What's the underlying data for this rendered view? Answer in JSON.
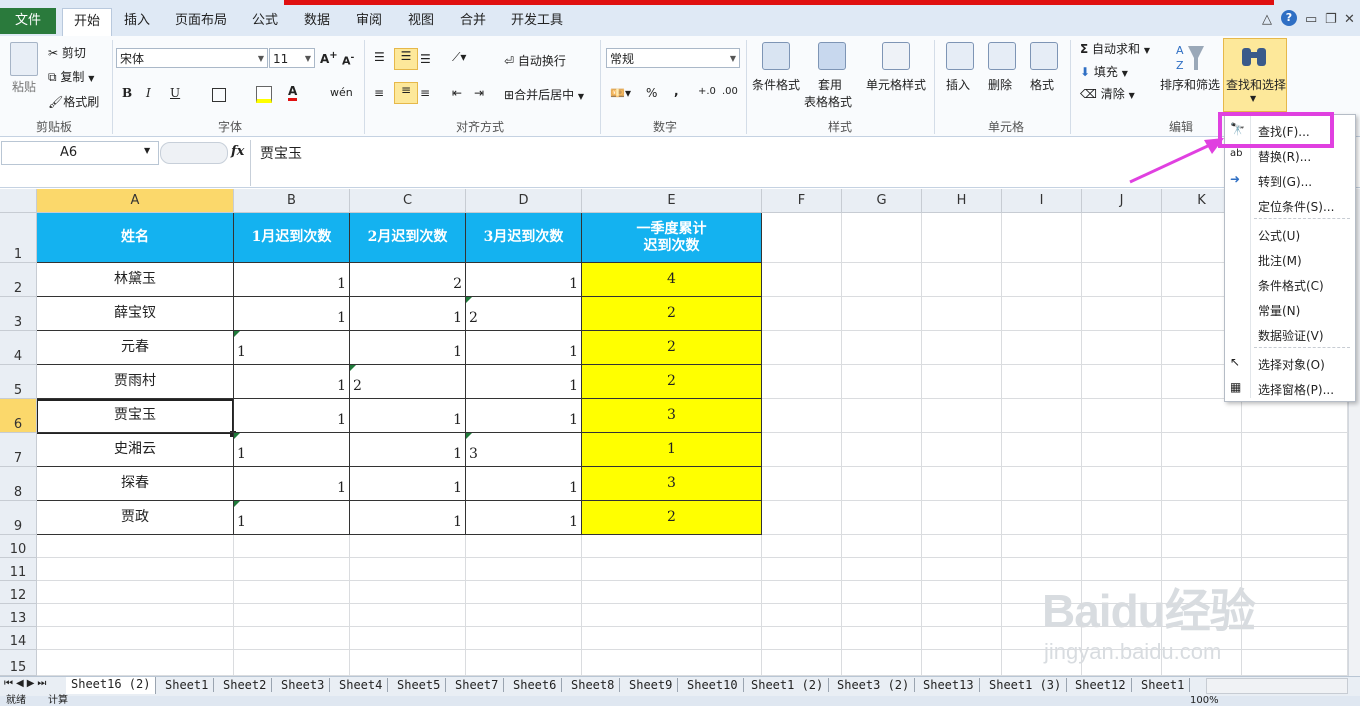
{
  "ribbon_tabs": [
    "文件",
    "开始",
    "插入",
    "页面布局",
    "公式",
    "数据",
    "审阅",
    "视图",
    "合并",
    "开发工具"
  ],
  "clipboard": {
    "paste": "粘贴",
    "cut": "剪切",
    "copy": "复制",
    "format_painter": "格式刷",
    "group": "剪贴板"
  },
  "font": {
    "name": "宋体",
    "size": "11",
    "bold": "B",
    "italic": "I",
    "underline": "U",
    "group": "字体"
  },
  "alignment": {
    "wrap": "自动换行",
    "merge": "合并后居中",
    "group": "对齐方式"
  },
  "number": {
    "format": "常规",
    "percent": "%",
    "comma": ",",
    "group": "数字"
  },
  "styles": {
    "conditional": "条件格式",
    "table_1": "套用",
    "table_2": "表格格式",
    "cell_styles": "单元格样式",
    "group": "样式"
  },
  "cells": {
    "insert": "插入",
    "delete": "删除",
    "format": "格式",
    "group": "单元格"
  },
  "editing": {
    "autosum": "自动求和",
    "fill": "填充",
    "clear": "清除",
    "sort": "排序和筛选",
    "find": "查找和选择",
    "group": "编辑"
  },
  "formula_bar": {
    "name_box": "A6",
    "fx": "fx",
    "value": "贾宝玉"
  },
  "columns": [
    "A",
    "B",
    "C",
    "D",
    "E",
    "F",
    "G",
    "H",
    "I",
    "J",
    "K"
  ],
  "rows": [
    "1",
    "2",
    "3",
    "4",
    "5",
    "6",
    "7",
    "8",
    "9",
    "10",
    "11",
    "12",
    "13",
    "14",
    "15"
  ],
  "table": {
    "headers": [
      "姓名",
      "1月迟到次数",
      "2月迟到次数",
      "3月迟到次数",
      "一季度累计",
      "迟到次数"
    ],
    "data": [
      [
        "林黛玉",
        "1",
        "2",
        "1",
        "4"
      ],
      [
        "薛宝钗",
        "1",
        "1",
        "2",
        "2"
      ],
      [
        "元春",
        "1",
        "1",
        "1",
        "2"
      ],
      [
        "贾雨村",
        "1",
        "2",
        "1",
        "2"
      ],
      [
        "贾宝玉",
        "1",
        "1",
        "1",
        "3"
      ],
      [
        "史湘云",
        "1",
        "1",
        "3",
        "1"
      ],
      [
        "探春",
        "1",
        "1",
        "1",
        "3"
      ],
      [
        "贾政",
        "1",
        "1",
        "1",
        "2"
      ]
    ]
  },
  "find_menu": [
    "查找(F)...",
    "替换(R)...",
    "转到(G)...",
    "定位条件(S)...",
    "公式(U)",
    "批注(M)",
    "条件格式(C)",
    "常量(N)",
    "数据验证(V)",
    "选择对象(O)",
    "选择窗格(P)..."
  ],
  "sheet_tabs": [
    "Sheet16 (2)",
    "Sheet1",
    "Sheet2",
    "Sheet3",
    "Sheet4",
    "Sheet5",
    "Sheet7",
    "Sheet6",
    "Sheet8",
    "Sheet9",
    "Sheet10",
    "Sheet1 (2)",
    "Sheet3 (2)",
    "Sheet13",
    "Sheet1 (3)",
    "Sheet12",
    "Sheet1"
  ],
  "status": {
    "ready": "就绪",
    "calc": "计算",
    "zoom": "100%"
  },
  "watermark": {
    "line1": "Baidu经验",
    "line2": "jingyan.baidu.com"
  },
  "colors": {
    "header_blue": "#14b2f0",
    "highlight_yellow": "#ffff00",
    "callout_magenta": "#e040e0",
    "file_green": "#2a7a3c"
  }
}
